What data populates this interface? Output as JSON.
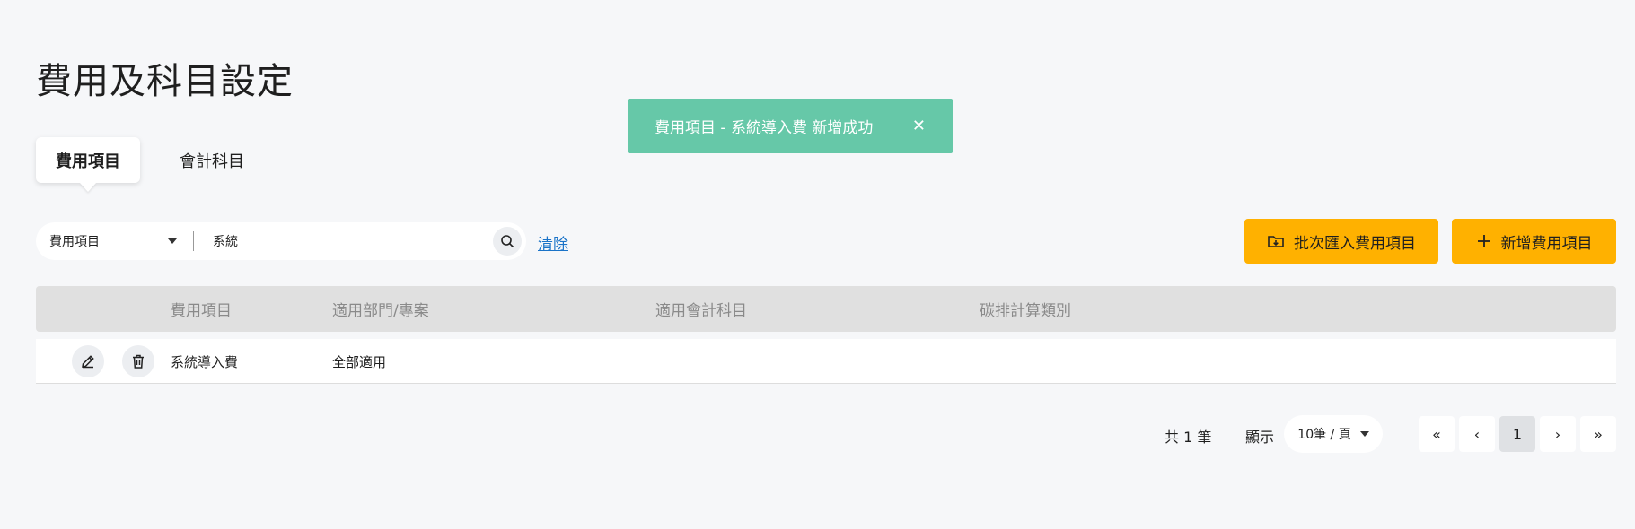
{
  "page_title": "費用及科目設定",
  "toast": {
    "message": "費用項目 - 系統導入費 新增成功",
    "close_icon": "close-icon",
    "color": "#66c8a8"
  },
  "tabs": [
    {
      "label": "費用項目",
      "active": true
    },
    {
      "label": "會計科目",
      "active": false
    }
  ],
  "filter": {
    "field_selected": "費用項目",
    "search_value": "系統",
    "clear_label": "清除"
  },
  "actions": {
    "import_label": "批次匯入費用項目",
    "add_label": "新增費用項目",
    "accent_color": "#ffb100"
  },
  "table": {
    "columns": [
      "費用項目",
      "適用部門/專案",
      "適用會計科目",
      "碳排計算類別"
    ],
    "rows": [
      {
        "item": "系統導入費",
        "department": "全部適用",
        "account": "",
        "carbon_category": ""
      }
    ]
  },
  "pagination": {
    "total_label": "共 1 筆",
    "show_label": "顯示",
    "page_size": "10筆 / 頁",
    "first": "«",
    "prev": "‹",
    "current_page": "1",
    "next": "›",
    "last": "»"
  }
}
